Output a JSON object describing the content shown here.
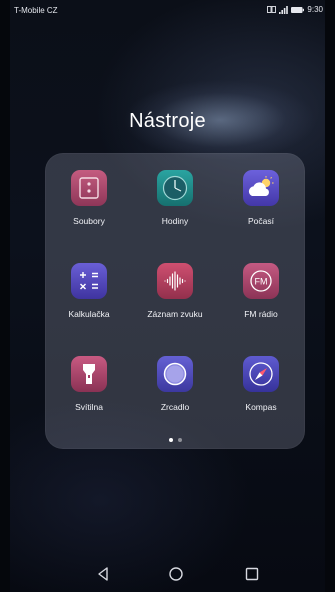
{
  "status_bar": {
    "carrier": "T-Mobile CZ",
    "time": "9:30"
  },
  "folder": {
    "title": "Nástroje",
    "apps": [
      {
        "label": "Soubory",
        "icon": "files-icon",
        "color": "#a24a69"
      },
      {
        "label": "Hodiny",
        "icon": "clock-icon",
        "color": "#1f8f8e"
      },
      {
        "label": "Počasí",
        "icon": "weather-icon",
        "color": "#5a4fc7"
      },
      {
        "label": "Kalkulačka",
        "icon": "calculator-icon",
        "color": "#5247b8"
      },
      {
        "label": "Záznam zvuku",
        "icon": "sound-recorder-icon",
        "color": "#b23f5e"
      },
      {
        "label": "FM rádio",
        "icon": "fm-radio-icon",
        "color": "#a5456a"
      },
      {
        "label": "Svítilna",
        "icon": "flashlight-icon",
        "color": "#a8456a"
      },
      {
        "label": "Zrcadlo",
        "icon": "mirror-icon",
        "color": "#4f4cbc"
      },
      {
        "label": "Kompas",
        "icon": "compass-icon",
        "color": "#4b47b7"
      }
    ],
    "pages": {
      "count": 2,
      "active": 1
    }
  },
  "nav": {
    "back": "back-icon",
    "home": "home-icon",
    "recents": "recents-icon"
  }
}
